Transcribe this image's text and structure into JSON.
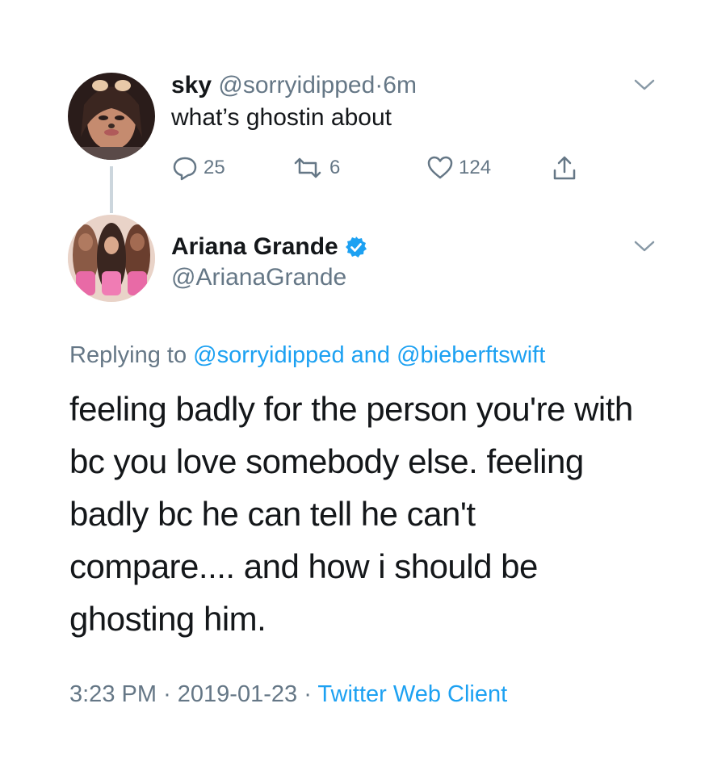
{
  "parent_tweet": {
    "display_name": "sky",
    "handle": "@sorryidipped",
    "separator": "·",
    "time_ago": "6m",
    "text": "what’s ghostin about",
    "replies": "25",
    "retweets": "6",
    "likes": "124",
    "icons": {
      "reply": "reply-icon",
      "retweet": "retweet-icon",
      "like": "heart-icon",
      "share": "share-icon",
      "menu": "chevron-down-icon"
    }
  },
  "main_tweet": {
    "display_name": "Ariana Grande",
    "handle": "@ArianaGrande",
    "verified_icon": "verified-badge-icon",
    "replying_prefix": "Replying to",
    "replying_user_1": "@sorryidipped",
    "replying_and": "and",
    "replying_user_2": "@bieberftswift",
    "body_lines": [
      "feeling badly for the person you're with",
      "bc you love somebody else. feeling",
      "badly bc he can tell he can't",
      "compare.... and how i should be",
      "ghosting him."
    ],
    "time": "3:23 PM",
    "date": "2019-01-23",
    "separator": "·",
    "client": "Twitter Web Client"
  },
  "colors": {
    "link_blue": "#1da1f2",
    "secondary_gray": "#657786",
    "text_dark": "#14171a",
    "thread_line": "#ccd6dd"
  }
}
